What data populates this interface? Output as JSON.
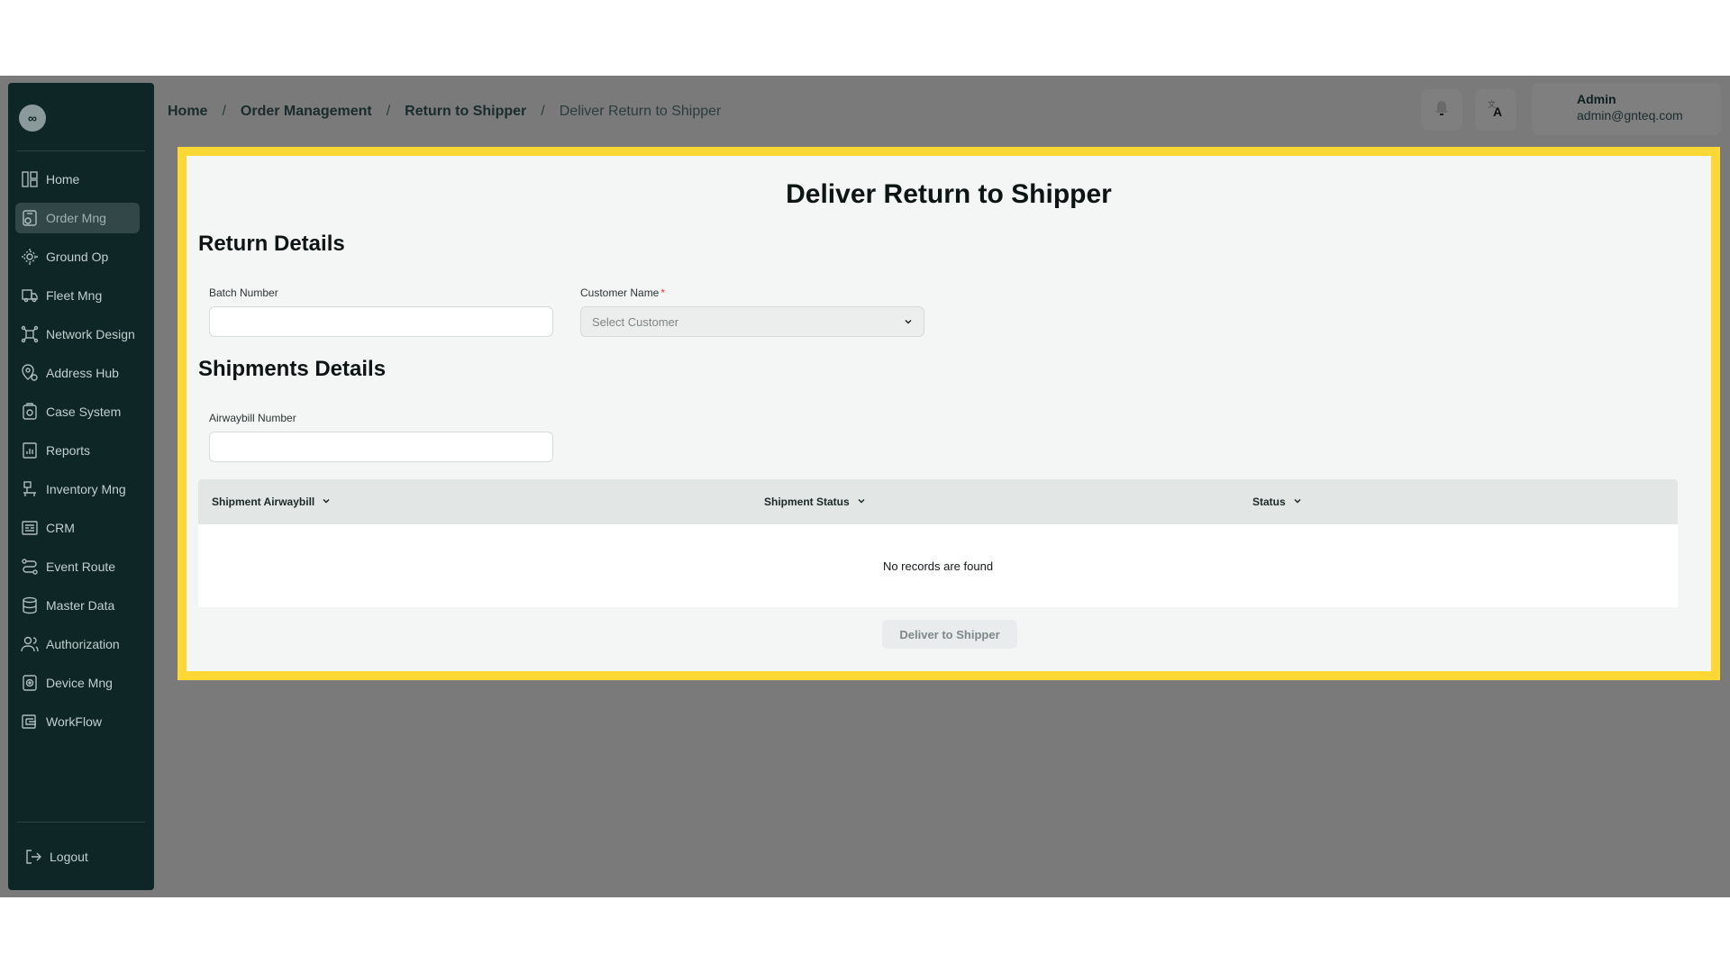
{
  "sidebar": {
    "logo_glyph": "∞",
    "items": [
      {
        "label": "Home",
        "icon": "home-grid-icon",
        "active": false
      },
      {
        "label": "Order Mng",
        "icon": "order-box-icon",
        "active": true
      },
      {
        "label": "Ground Op",
        "icon": "ground-op-icon",
        "active": false
      },
      {
        "label": "Fleet Mng",
        "icon": "truck-icon",
        "active": false
      },
      {
        "label": "Network Design",
        "icon": "network-icon",
        "active": false
      },
      {
        "label": "Address Hub",
        "icon": "map-pin-icon",
        "active": false
      },
      {
        "label": "Case System",
        "icon": "case-icon",
        "active": false
      },
      {
        "label": "Reports",
        "icon": "report-chart-icon",
        "active": false
      },
      {
        "label": "Inventory Mng",
        "icon": "inventory-icon",
        "active": false
      },
      {
        "label": "CRM",
        "icon": "crm-icon",
        "active": false
      },
      {
        "label": "Event Route",
        "icon": "route-icon",
        "active": false
      },
      {
        "label": "Master Data",
        "icon": "database-icon",
        "active": false
      },
      {
        "label": "Authorization",
        "icon": "users-icon",
        "active": false
      },
      {
        "label": "Device Mng",
        "icon": "device-icon",
        "active": false
      },
      {
        "label": "WorkFlow",
        "icon": "workflow-icon",
        "active": false
      }
    ],
    "logout": {
      "label": "Logout",
      "icon": "logout-icon"
    }
  },
  "header": {
    "breadcrumb": [
      "Home",
      "Order Management",
      "Return to Shipper",
      "Deliver Return to Shipper"
    ],
    "user": {
      "name": "Admin",
      "email": "admin@gnteq.com"
    }
  },
  "main": {
    "title": "Deliver Return to Shipper",
    "return_details": {
      "title": "Return Details",
      "batch_label": "Batch Number",
      "batch_value": "",
      "customer_label": "Customer Name",
      "customer_required": "*",
      "customer_placeholder": "Select Customer"
    },
    "shipment_details": {
      "title": "Shipments Details",
      "awb_label": "Airwaybill Number",
      "awb_value": ""
    },
    "table": {
      "columns": [
        "Shipment Airwaybill",
        "Shipment Status",
        "Status"
      ],
      "empty_text": "No records are found"
    },
    "deliver_button": "Deliver to Shipper"
  },
  "colors": {
    "sidebar_bg": "#0e2626",
    "highlight": "#fdd835",
    "overlay": "#7a7a7a"
  }
}
